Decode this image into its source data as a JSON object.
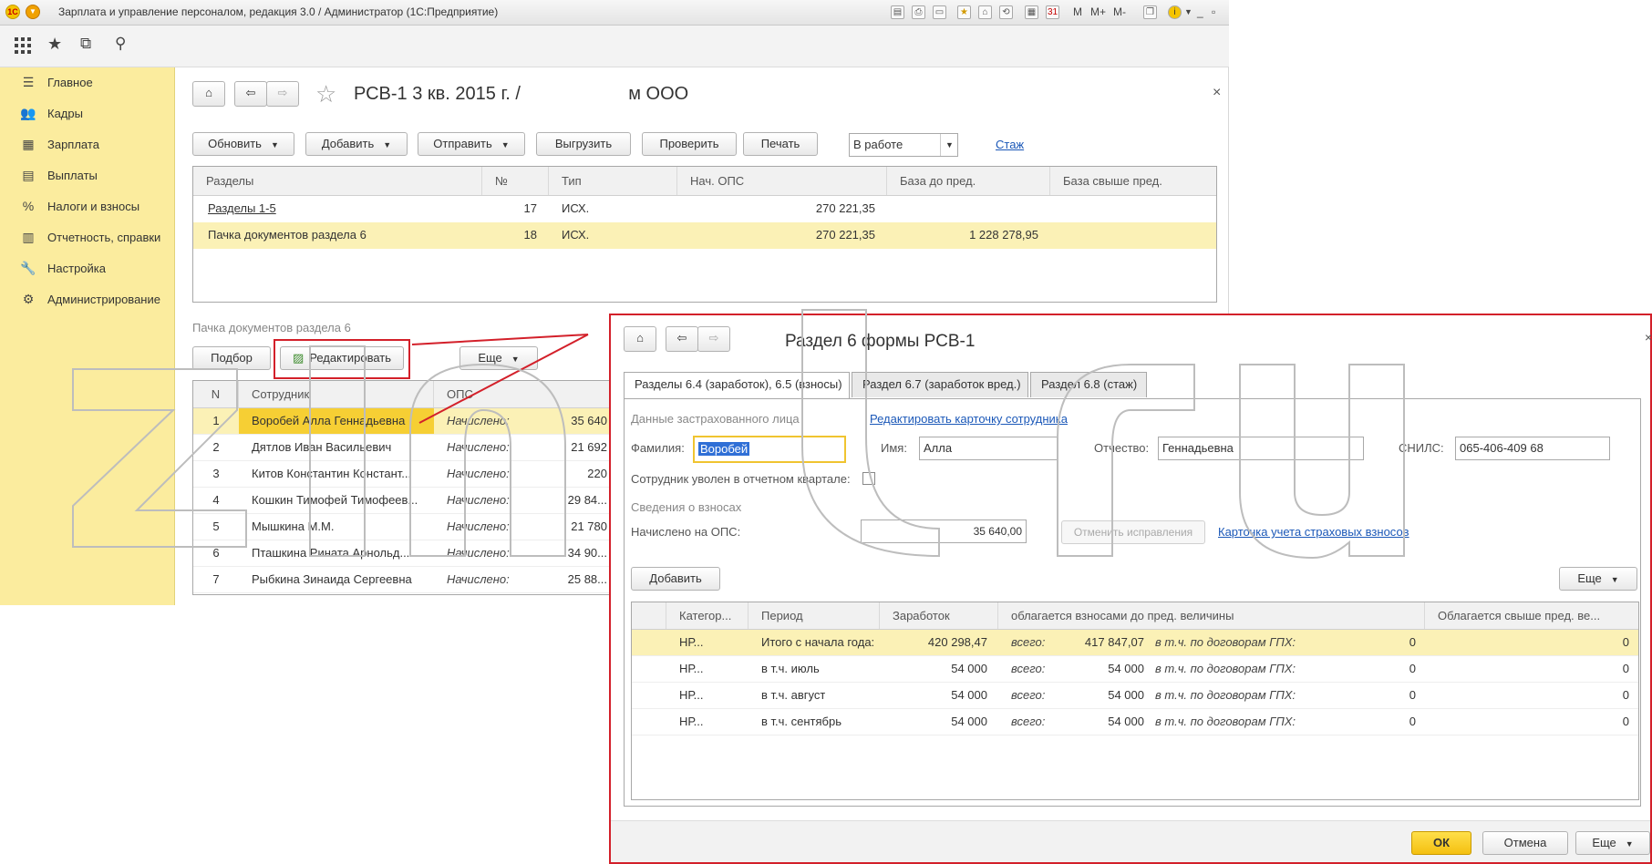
{
  "window": {
    "title": "Зарплата и управление персоналом, редакция 3.0 / Администратор  (1С:Предприятие)",
    "buttons": [
      "M",
      "M+",
      "M-"
    ]
  },
  "sidebar": {
    "items": [
      {
        "label": "Главное",
        "icon": "menu-lines-icon"
      },
      {
        "label": "Кадры",
        "icon": "people-icon"
      },
      {
        "label": "Зарплата",
        "icon": "calculator-icon"
      },
      {
        "label": "Выплаты",
        "icon": "cash-icon"
      },
      {
        "label": "Налоги и взносы",
        "icon": "percent-icon"
      },
      {
        "label": "Отчетность, справки",
        "icon": "report-icon"
      },
      {
        "label": "Настройка",
        "icon": "wrench-icon"
      },
      {
        "label": "Администрирование",
        "icon": "gear-icon"
      }
    ]
  },
  "doc": {
    "title": "РСВ-1 3 кв. 2015 г. /  ",
    "title_tail": "  м ООО",
    "toolbar": {
      "refresh": "Обновить",
      "add": "Добавить",
      "send": "Отправить",
      "export": "Выгрузить",
      "check": "Проверить",
      "print": "Печать",
      "status": "В работе",
      "stazh": "Стаж"
    },
    "sections_table": {
      "headers": [
        "Разделы",
        "№",
        "Тип",
        "Нач. ОПС",
        "База до пред.",
        "База свыше пред."
      ],
      "rows": [
        {
          "name": "Разделы 1-5",
          "num": "17",
          "type": "ИСХ.",
          "ops": "270 221,35",
          "base": "",
          "over": ""
        },
        {
          "name": "Пачка документов раздела 6",
          "num": "18",
          "type": "ИСХ.",
          "ops": "270 221,35",
          "base": "1 228 278,95",
          "over": ""
        }
      ]
    },
    "pack": {
      "caption": "Пачка документов раздела 6",
      "pick": "Подбор",
      "edit": "Редактировать",
      "more": "Еще",
      "headers": [
        "N",
        "Сотрудник",
        "ОПС"
      ],
      "rows": [
        {
          "n": "1",
          "name": "Воробей Алла Геннадьевна",
          "status": "Начислено:",
          "ops": "35 640"
        },
        {
          "n": "2",
          "name": "Дятлов Иван Васильевич",
          "status": "Начислено:",
          "ops": "21 692"
        },
        {
          "n": "3",
          "name": "Китов Константин Констант...",
          "status": "Начислено:",
          "ops": "220"
        },
        {
          "n": "4",
          "name": "Кошкин Тимофей Тимофеев...",
          "status": "Начислено:",
          "ops": "29 84..."
        },
        {
          "n": "5",
          "name": "Мышкина М.М.",
          "status": "Начислено:",
          "ops": "21 780"
        },
        {
          "n": "6",
          "name": "Пташкина Рината Арнольд...",
          "status": "Начислено:",
          "ops": "34 90..."
        },
        {
          "n": "7",
          "name": "Рыбкина Зинаида Сергеевна",
          "status": "Начислено:",
          "ops": "25 88..."
        }
      ]
    }
  },
  "dialog": {
    "title": "Раздел 6 формы РСВ-1",
    "tabs": [
      "Разделы 6.4 (заработок), 6.5 (взносы)",
      "Раздел 6.7 (заработок вред.)",
      "Раздел 6.8 (стаж)"
    ],
    "insured_group": "Данные застрахованного лица",
    "edit_card_link": "Редактировать карточку сотрудника",
    "lastname_label": "Фамилия:",
    "lastname": "Воробей",
    "firstname_label": "Имя:",
    "firstname": "Алла",
    "patronymic_label": "Отчество:",
    "patronymic": "Геннадьевна",
    "snils_label": "СНИЛС:",
    "snils": "065-406-409 68",
    "dismissed_label": "Сотрудник уволен в отчетном квартале:",
    "contrib_group": "Сведения о взносах",
    "ops_label": "Начислено на ОПС:",
    "ops_value": "35 640,00",
    "undo_button": "Отменить исправления",
    "card_link": "Карточка учета страховых взносов",
    "add_button": "Добавить",
    "more_button": "Еще",
    "table": {
      "headers": [
        "Категор...",
        "Период",
        "Заработок",
        "облагается взносами до пред. величины",
        "Облагается свыше пред. ве..."
      ],
      "rows": [
        {
          "cat": "НР...",
          "period": "Итого с начала года:",
          "earn": "420 298,47",
          "all_label": "всего:",
          "all": "417 847,07",
          "gph_label": "в т.ч. по договорам ГПХ:",
          "gph": "0",
          "over": "0"
        },
        {
          "cat": "НР...",
          "period": "в т.ч. июль",
          "earn": "54 000",
          "all_label": "всего:",
          "all": "54 000",
          "gph_label": "в т.ч. по договорам ГПХ:",
          "gph": "0",
          "over": "0"
        },
        {
          "cat": "НР...",
          "period": "в т.ч. август",
          "earn": "54 000",
          "all_label": "всего:",
          "all": "54 000",
          "gph_label": "в т.ч. по договорам ГПХ:",
          "gph": "0",
          "over": "0"
        },
        {
          "cat": "НР...",
          "period": "в т.ч. сентябрь",
          "earn": "54 000",
          "all_label": "всего:",
          "all": "54 000",
          "gph_label": "в т.ч. по договорам ГПХ:",
          "gph": "0",
          "over": "0"
        }
      ]
    },
    "ok": "ОК",
    "cancel": "Отмена",
    "more": "Еще"
  },
  "colors": {
    "sidebar": "#fbec9e",
    "selection": "#f6cf34",
    "highlight_row": "#fbf1b6",
    "annotation": "#d3202a",
    "link": "#1b58b8"
  }
}
